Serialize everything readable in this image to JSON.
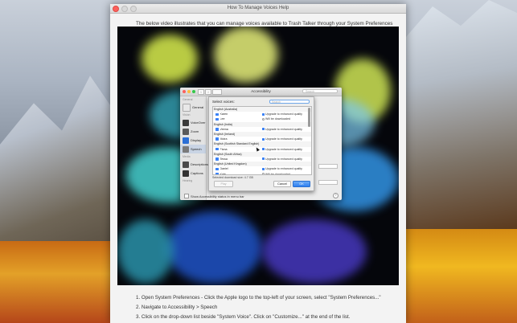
{
  "window": {
    "title": "How To Manage Voices Help",
    "intro": "The below video illustrates that you can manage voices available to Trash Talker through your System Preferences"
  },
  "prefs_dialog": {
    "title": "Accessibility",
    "search_placeholder": "Search",
    "sidebar_heading": "General",
    "sidebar_subheading_vision": "Vision",
    "sidebar_subheading_media": "Media",
    "sidebar_subheading_hearing": "Hearing",
    "sidebar_items": [
      {
        "label": "General",
        "icon": "general-icon",
        "color": "#e8e8e8"
      },
      {
        "label": "VoiceOver",
        "icon": "voiceover-icon",
        "color": "#3a3a3a"
      },
      {
        "label": "Zoom",
        "icon": "zoom-icon",
        "color": "#5a5a5a"
      },
      {
        "label": "Display",
        "icon": "display-icon",
        "color": "#2b6fd6"
      },
      {
        "label": "Speech",
        "icon": "speech-icon",
        "color": "#7a7a7a",
        "selected": true
      },
      {
        "label": "Descriptions",
        "icon": "descriptions-icon",
        "color": "#4a4a4a"
      },
      {
        "label": "Captions",
        "icon": "captions-icon",
        "color": "#333333"
      }
    ],
    "show_status_label": "Show Accessibility status in menu bar",
    "help_label": "?"
  },
  "voice_sheet": {
    "label": "Select voices:",
    "search_placeholder": "Search",
    "rows": [
      {
        "type": "voice",
        "name": "Karen",
        "status": "Upgrade to enhanced quality"
      },
      {
        "type": "voice",
        "name": "Lee",
        "status": "Will be downloaded"
      },
      {
        "type": "group",
        "name": "English (India)"
      },
      {
        "type": "voice",
        "name": "Veena",
        "status": "Upgrade to enhanced quality"
      },
      {
        "type": "group",
        "name": "English (Ireland)"
      },
      {
        "type": "voice",
        "name": "Moira",
        "status": "Upgrade to enhanced quality"
      },
      {
        "type": "group",
        "name": "English (Scottish Standard English)"
      },
      {
        "type": "voice",
        "name": "Fiona",
        "status": "Upgrade to enhanced quality"
      },
      {
        "type": "group",
        "name": "English (South Africa)"
      },
      {
        "type": "voice",
        "name": "Tessa",
        "status": "Upgrade to enhanced quality"
      },
      {
        "type": "group",
        "name": "English (United Kingdom)"
      },
      {
        "type": "voice",
        "name": "Daniel",
        "status": "Upgrade to enhanced quality"
      },
      {
        "type": "voice",
        "name": "Kate",
        "status": "Will be downloaded"
      }
    ],
    "first_group": "English (Australia)",
    "download_size": "Selected download size: 4.7 GB",
    "play_label": "Play",
    "cancel_label": "Cancel",
    "ok_label": "OK"
  },
  "steps": [
    "1. Open System Preferences - Click the Apple logo to the top-left of your screen, select \"System Preferences...\"",
    "2. Navigate to Accessibility > Speech",
    "3. Click on the drop-down list beside \"System Voice\". Click on \"Customize...\" at the end of the list."
  ]
}
